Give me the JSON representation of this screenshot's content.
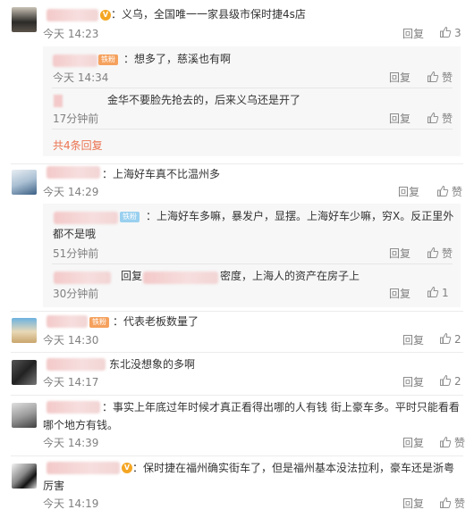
{
  "actions": {
    "reply": "回复",
    "like": "赞"
  },
  "comments": [
    {
      "text": "：义乌，全国唯一一家县级市保时捷4s店",
      "time": "今天 14:23",
      "likes": "3",
      "replies": [
        {
          "text": "：想多了，慈溪也有啊",
          "time": "今天 14:34",
          "badge": "铁粉"
        },
        {
          "text": "金华不要脸先抢去的，后来义乌还是开了",
          "time": "17分钟前"
        }
      ],
      "more": "共4条回复"
    },
    {
      "text": "：上海好车真不比温州多",
      "time": "今天 14:29",
      "likes": "",
      "replies": [
        {
          "text": "：上海好车多嘛，暴发户，显摆。上海好车少嘛，穷X。反正里外",
          "text2": "都不是哦",
          "time": "51分钟前",
          "badge": "铁粉"
        },
        {
          "prefix": "回复",
          "text": "密度，上海人的资产在房子上",
          "time": "30分钟前",
          "likes": "1"
        }
      ]
    },
    {
      "text": "：代表老板数量了",
      "time": "今天 14:30",
      "likes": "2",
      "badge": "铁粉"
    },
    {
      "text": "东北没想象的多啊",
      "time": "今天 14:17",
      "likes": "2"
    },
    {
      "text": "：事实上年底过年时候才真正看得出哪的人有钱 街上豪车多。平时只能看看",
      "text2": "哪个地方有钱。",
      "time": "今天 14:39",
      "likes": ""
    },
    {
      "text": "：保时捷在福州确实街车了，但是福州基本没法拉利，豪车还是浙粤",
      "text2": "厉害",
      "time": "今天 14:19",
      "likes": ""
    }
  ]
}
